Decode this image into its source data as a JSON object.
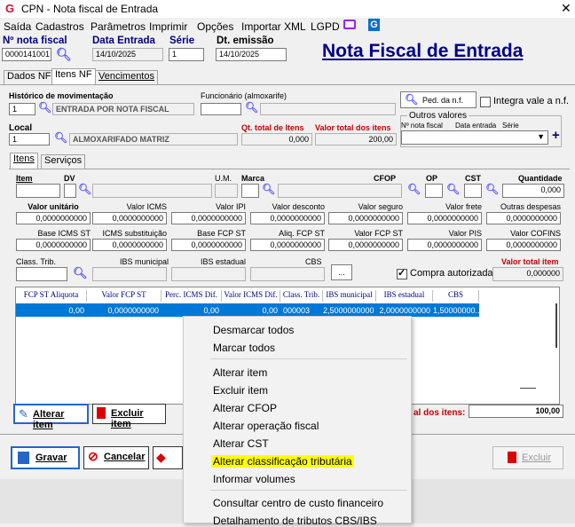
{
  "window": {
    "title": "CPN - Nota fiscal de Entrada",
    "close": "✕",
    "logo": "G"
  },
  "menubar": [
    "Saída",
    "Cadastros",
    "Parâmetros",
    "Imprimir",
    "Opções",
    "Importar XML",
    "LGPD"
  ],
  "header": {
    "nf_label": "Nº nota fiscal",
    "nf_value": "0000141001",
    "data_entrada_label": "Data Entrada",
    "data_entrada_value": "14/10/2025",
    "serie_label": "Série",
    "serie_value": "1",
    "dt_emissao_label": "Dt. emissão",
    "dt_emissao_value": "14/10/2025",
    "big_title": "Nota Fiscal de Entrada"
  },
  "top_tabs": [
    "Dados NF",
    "Itens NF",
    "Vencimentos"
  ],
  "historico": {
    "label": "Histórico de movimentação",
    "code": "1",
    "desc": "ENTRADA POR NOTA FISCAL"
  },
  "funcionario": {
    "label": "Funcionário (almoxarife)"
  },
  "ped_button": "Ped. da n.f.",
  "integra": "Integra vale a n.f.",
  "local": {
    "label": "Local",
    "code": "1",
    "desc": "ALMOXARIFADO MATRIZ"
  },
  "qt_total": {
    "label": "Qt. total de Itens",
    "value": "0,000"
  },
  "valor_total": {
    "label": "Valor total dos itens",
    "value": "200,00"
  },
  "outros": {
    "label": "Outros valores",
    "col1": "Nº nota fiscal",
    "col2": "Data entrada",
    "col3": "Série",
    "plus": "+"
  },
  "inner_tabs": [
    "Itens",
    "Serviços"
  ],
  "item_row": {
    "item": "Item",
    "dv": "DV",
    "um": "U.M.",
    "marca": "Marca",
    "cfop": "CFOP",
    "op": "OP",
    "cst": "CST",
    "quantidade": "Quantidade",
    "qt_value": "0,000"
  },
  "row2": [
    {
      "label": "Valor unitário",
      "value": "0,0000000000",
      "bold": true
    },
    {
      "label": "Valor ICMS",
      "value": "0,0000000000"
    },
    {
      "label": "Valor IPI",
      "value": "0,0000000000"
    },
    {
      "label": "Valor desconto",
      "value": "0,0000000000"
    },
    {
      "label": "Valor seguro",
      "value": "0,0000000000"
    },
    {
      "label": "Valor frete",
      "value": "0,0000000000"
    },
    {
      "label": "Outras despesas",
      "value": "0,0000000000"
    }
  ],
  "row3": [
    {
      "label": "Base ICMS ST",
      "value": "0,0000000000"
    },
    {
      "label": "ICMS substituição",
      "value": "0,0000000000"
    },
    {
      "label": "Base FCP ST",
      "value": "0,0000000000"
    },
    {
      "label": "Aliq. FCP ST",
      "value": "0,0000000000"
    },
    {
      "label": "Valor FCP ST",
      "value": "0,0000000000"
    },
    {
      "label": "Valor PIS",
      "value": "0,0000000000"
    },
    {
      "label": "Valor COFINS",
      "value": "0,0000000000"
    }
  ],
  "row4": {
    "class_trib": "Class. Trib.",
    "ibs_mun": "IBS municipal",
    "ibs_est": "IBS estadual",
    "cbs": "CBS",
    "dots": "...",
    "compra": "Compra autorizada",
    "vt_label": "Valor total item",
    "vt_value": "0,000000"
  },
  "grid": {
    "headers": [
      "FCP ST Aliquota",
      "Valor FCP ST",
      "Perc. ICMS Dif.",
      "Valor ICMS Dif.",
      "Class. Trib.",
      "IBS municipal",
      "IBS estadual",
      "CBS"
    ],
    "row": [
      "0,00",
      "0,0000000000",
      "0,00",
      "0,00",
      "000003",
      "2,5000000000",
      "2,0000000000",
      "1,50000000..."
    ]
  },
  "buttons": {
    "alterar": "Alterar item",
    "excluir_item": "Excluir item",
    "gravar": "Gravar",
    "cancelar": "Cancelar",
    "excluir": "Excluir"
  },
  "total_itens": {
    "label": "al dos itens:",
    "value": "100,00"
  },
  "context_menu": [
    "Desmarcar todos",
    "Marcar todos",
    "Alterar item",
    "Excluir item",
    "Alterar CFOP",
    "Alterar operação fiscal",
    "Alterar CST",
    "Alterar classificação tributária",
    "Informar volumes",
    "Consultar centro de custo financeiro",
    "Detalhamento de tributos CBS/IBS"
  ]
}
